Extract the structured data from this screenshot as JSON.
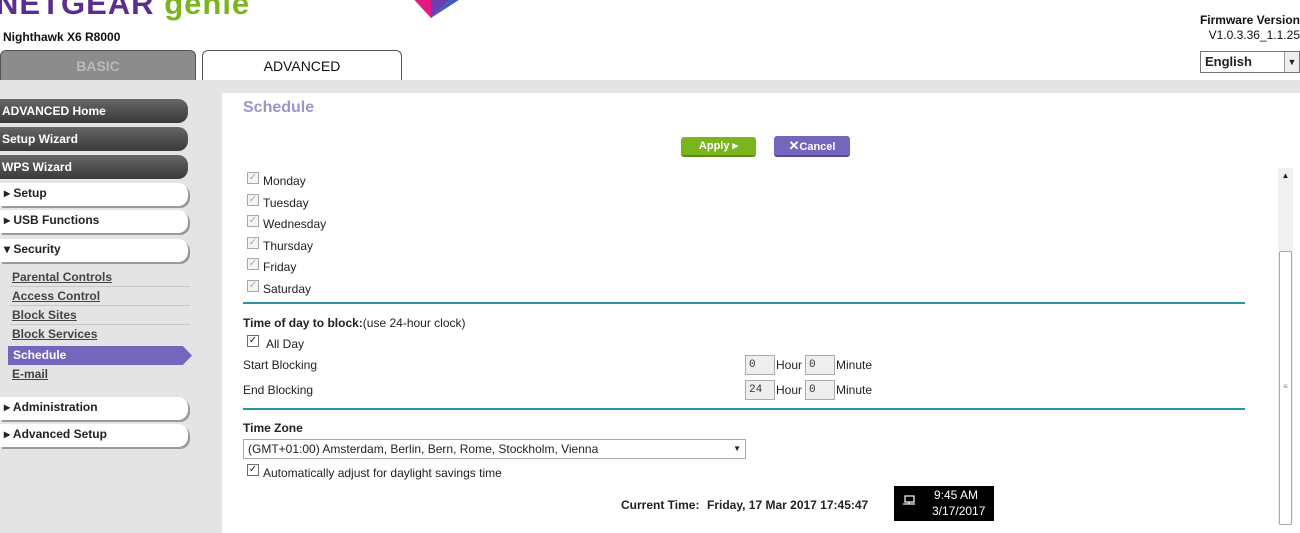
{
  "header": {
    "brand": "NETGEAR",
    "product": "genie",
    "model": "Nighthawk X6 R8000",
    "firmware_label": "Firmware Version",
    "firmware_value": "V1.0.3.36_1.1.25"
  },
  "tabs": [
    {
      "label": "BASIC",
      "active": false
    },
    {
      "label": "ADVANCED",
      "active": true
    }
  ],
  "language": {
    "selected": "English"
  },
  "sidebar": {
    "advanced_home": "ADVANCED Home",
    "setup_wizard": "Setup Wizard",
    "wps_wizard": "WPS Wizard",
    "setup": "▸ Setup",
    "usb_functions": "▸ USB Functions",
    "security": "▾ Security",
    "security_items": [
      "Parental Controls",
      "Access Control",
      "Block Sites",
      "Block Services",
      "Schedule",
      "E-mail"
    ],
    "administration": "▸ Administration",
    "advanced_setup": "▸ Advanced Setup"
  },
  "main": {
    "title": "Schedule",
    "apply_label": "Apply ▸",
    "cancel_label": "Cancel",
    "days": [
      {
        "label": "Monday",
        "checked": true
      },
      {
        "label": "Tuesday",
        "checked": true
      },
      {
        "label": "Wednesday",
        "checked": true
      },
      {
        "label": "Thursday",
        "checked": true
      },
      {
        "label": "Friday",
        "checked": true
      },
      {
        "label": "Saturday",
        "checked": true
      }
    ],
    "time_heading_bold": "Time of day to block:",
    "time_heading_note": "(use 24-hour clock)",
    "all_day_label": "All Day",
    "all_day_checked": true,
    "start_label": "Start Blocking",
    "start_hour": "0",
    "start_minute": "0",
    "end_label": "End Blocking",
    "end_hour": "24",
    "end_minute": "0",
    "hour_label": "Hour",
    "minute_label": "Minute",
    "timezone_heading": "Time Zone",
    "timezone_value": "(GMT+01:00) Amsterdam, Berlin, Bern, Rome, Stockholm, Vienna",
    "dst_label": "Automatically adjust for daylight savings time",
    "dst_checked": true,
    "current_time_label": "Current Time:",
    "current_time_value": "Friday, 17 Mar 2017 17:45:47"
  },
  "taskbar_clock": {
    "time": "9:45 AM",
    "date": "3/17/2017"
  },
  "colors": {
    "brand_purple": "#5b2d8e",
    "genie_green": "#7ab51d",
    "accent_purple": "#7366bd",
    "divider_teal": "#2a93a8"
  }
}
